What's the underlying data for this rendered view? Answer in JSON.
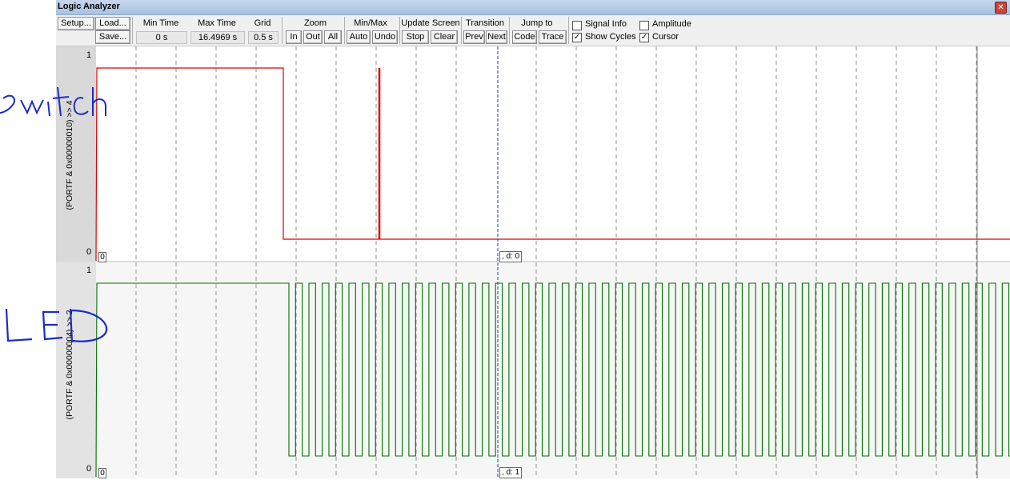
{
  "window": {
    "title": "Logic Analyzer"
  },
  "toolbar": {
    "setup_label": "Setup...",
    "load_label": "Load...",
    "save_label": "Save...",
    "min_time": {
      "label": "Min Time",
      "value": "0 s"
    },
    "max_time": {
      "label": "Max Time",
      "value": "16.4969 s"
    },
    "grid": {
      "label": "Grid",
      "value": "0.5 s"
    },
    "zoom": {
      "label": "Zoom",
      "in": "In",
      "out": "Out",
      "all": "All"
    },
    "minmax": {
      "label": "Min/Max",
      "auto": "Auto",
      "undo": "Undo"
    },
    "update_screen": {
      "label": "Update Screen",
      "stop": "Stop",
      "clear": "Clear"
    },
    "transition": {
      "label": "Transition",
      "prev": "Prev",
      "next": "Next"
    },
    "jump_to": {
      "label": "Jump to",
      "code": "Code",
      "trace": "Trace"
    },
    "options": {
      "signal_info": {
        "label": "Signal Info",
        "checked": false
      },
      "amplitude": {
        "label": "Amplitude",
        "checked": false
      },
      "show_cycles": {
        "label": "Show Cycles",
        "checked": true
      },
      "cursor": {
        "label": "Cursor",
        "checked": true
      }
    }
  },
  "signals": [
    {
      "name": "(PORTF & 0x00000010) >> 4",
      "y_high": "1",
      "y_low": "0",
      "zero_marker": "0",
      "cursor_readout": ", d: 0",
      "color": "#e00000",
      "annotation": "switch"
    },
    {
      "name": "(PORTF & 0x00000004) >> 2",
      "y_high": "1",
      "y_low": "0",
      "zero_marker": "0",
      "cursor_readout": ", d: 1",
      "color": "#007000",
      "annotation": "LED"
    }
  ],
  "colors": {
    "toolbar_bg": "#f0f0f0",
    "titlebar": "#b9cde6",
    "plot_bg": "#ffffff",
    "cursor": "#2040c0"
  }
}
